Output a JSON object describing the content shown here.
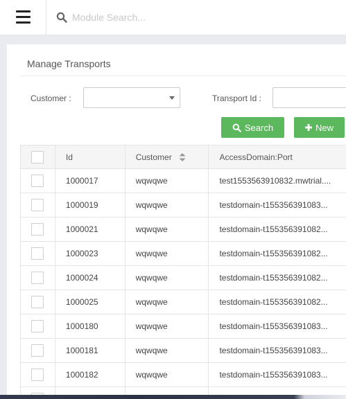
{
  "header": {
    "menu_icon": "hamburger-menu-icon",
    "search_icon": "search-icon",
    "search_placeholder": "Module Search..."
  },
  "page": {
    "title": "Manage Transports"
  },
  "filters": {
    "customer_label": "Customer :",
    "customer_value": "",
    "transport_id_label": "Transport Id :",
    "transport_id_value": ""
  },
  "actions": {
    "search_label": "Search",
    "new_label": "New"
  },
  "colors": {
    "accent_green": "#5cb85c",
    "page_background": "#e9ebf1"
  },
  "table": {
    "columns": [
      "Id",
      "Customer",
      "AccessDomain:Port"
    ],
    "rows": [
      {
        "id": "1000017",
        "customer": "wqwqwe",
        "domain": "test1553563910832.mwtrial...."
      },
      {
        "id": "1000019",
        "customer": "wqwqwe",
        "domain": "testdomain-t155356391083..."
      },
      {
        "id": "1000021",
        "customer": "wqwqwe",
        "domain": "testdomain-t155356391082..."
      },
      {
        "id": "1000023",
        "customer": "wqwqwe",
        "domain": "testdomain-t155356391082..."
      },
      {
        "id": "1000024",
        "customer": "wqwqwe",
        "domain": "testdomain-t155356391082..."
      },
      {
        "id": "1000025",
        "customer": "wqwqwe",
        "domain": "testdomain-t155356391082..."
      },
      {
        "id": "1000180",
        "customer": "wqwqwe",
        "domain": "testdomain-t155356391083..."
      },
      {
        "id": "1000181",
        "customer": "wqwqwe",
        "domain": "testdomain-t155356391083..."
      },
      {
        "id": "1000182",
        "customer": "wqwqwe",
        "domain": "testdomain-t155356391083..."
      }
    ]
  }
}
